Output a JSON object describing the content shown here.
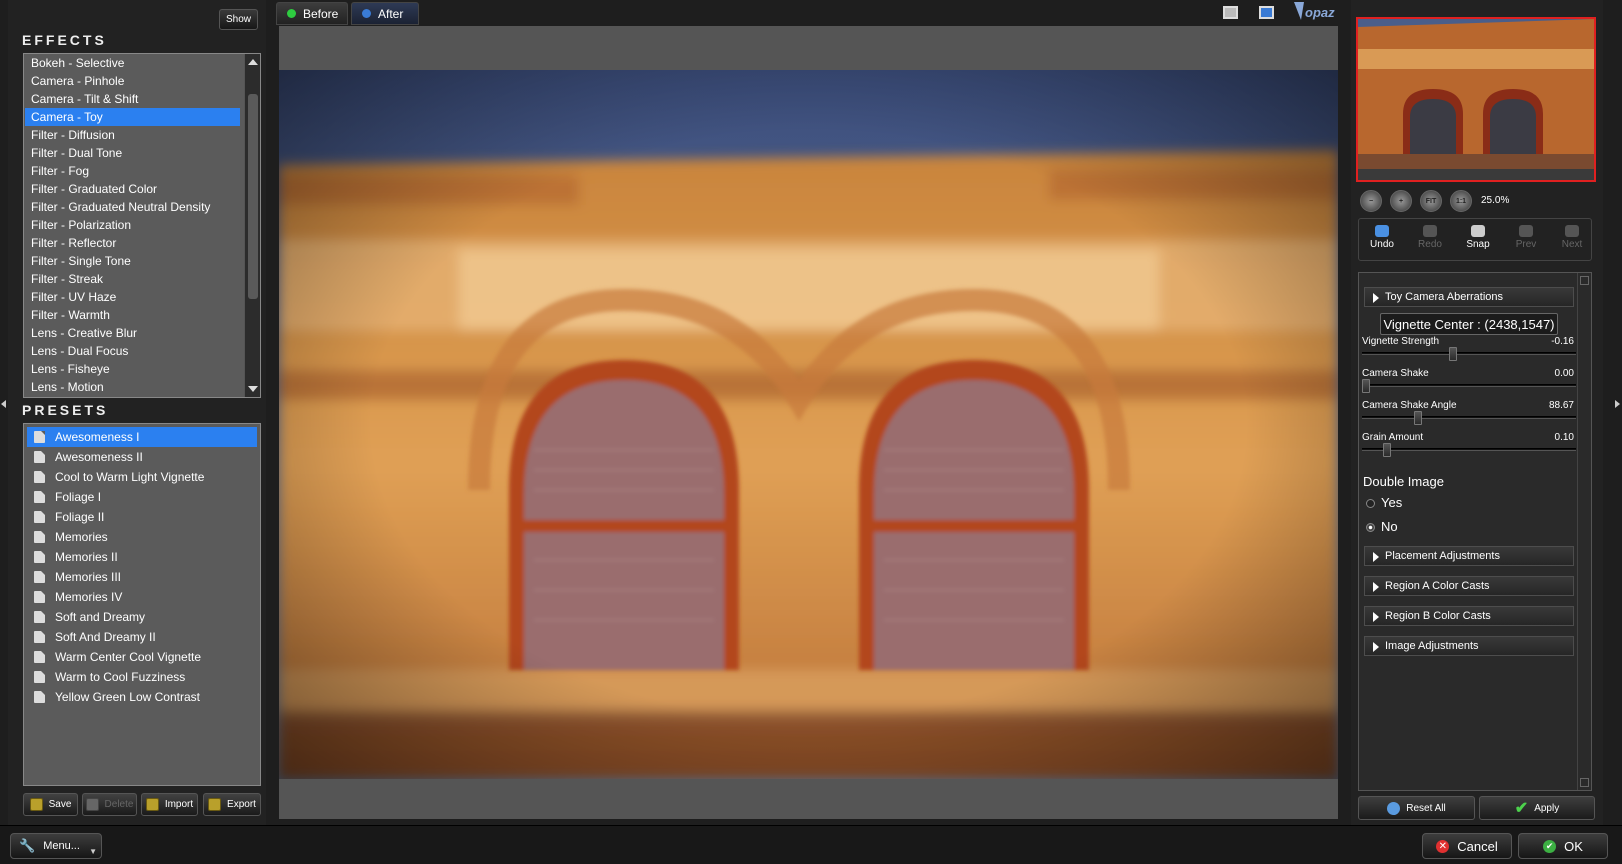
{
  "left_panel": {
    "show_label": "Show",
    "effects_title": "EFFECTS",
    "effects": [
      "Bokeh - Selective",
      "Camera - Pinhole",
      "Camera - Tilt & Shift",
      "Camera - Toy",
      "Filter - Diffusion",
      "Filter - Dual Tone",
      "Filter - Fog",
      "Filter - Graduated Color",
      "Filter - Graduated Neutral Density",
      "Filter - Polarization",
      "Filter - Reflector",
      "Filter - Single Tone",
      "Filter - Streak",
      "Filter - UV Haze",
      "Filter - Warmth",
      "Lens - Creative Blur",
      "Lens - Dual Focus",
      "Lens - Fisheye",
      "Lens - Motion"
    ],
    "selected_effect": "Camera - Toy",
    "presets_title": "PRESETS",
    "presets": [
      "Awesomeness I",
      "Awesomeness II",
      "Cool to Warm Light Vignette",
      "Foliage I",
      "Foliage II",
      "Memories",
      "Memories II",
      "Memories III",
      "Memories IV",
      "Soft and Dreamy",
      "Soft And Dreamy II",
      "Warm Center Cool Vignette",
      "Warm to Cool Fuzziness",
      "Yellow Green Low Contrast"
    ],
    "selected_preset": "Awesomeness I",
    "buttons": {
      "save": "Save",
      "delete": "Delete",
      "import": "Import",
      "export": "Export"
    }
  },
  "view": {
    "before_label": "Before",
    "after_label": "After",
    "active": "After",
    "before_dot_color": "#2ecc40",
    "after_dot_color": "#3a7bd5"
  },
  "navigator": {
    "zoom": "25.0%",
    "fit_label": "FIT",
    "one_to_one_label": "1:1"
  },
  "history": {
    "undo": "Undo",
    "redo": "Redo",
    "snap": "Snap",
    "prev": "Prev",
    "next": "Next"
  },
  "settings": {
    "toy_section": "Toy Camera Aberrations",
    "vignette_center": "Vignette Center : (2438,1547)",
    "sliders": [
      {
        "label": "Vignette Strength",
        "value": "-0.16",
        "pos": 0.42
      },
      {
        "label": "Camera Shake",
        "value": "0.00",
        "pos": 0.0
      },
      {
        "label": "Camera Shake Angle",
        "value": "88.67",
        "pos": 0.25
      },
      {
        "label": "Grain Amount",
        "value": "0.10",
        "pos": 0.1
      }
    ],
    "double_image_label": "Double Image",
    "options": [
      "Yes",
      "No"
    ],
    "selected_option": "No",
    "sections": [
      "Placement Adjustments",
      "Region A Color Casts",
      "Region B Color Casts",
      "Image Adjustments"
    ],
    "reset_all": "Reset All",
    "apply": "Apply"
  },
  "bottom": {
    "menu": "Menu...",
    "cancel": "Cancel",
    "ok": "OK"
  },
  "colors": {
    "selection": "#2b80f0",
    "thumb_border": "#e02020",
    "list_bg": "#5b5b5b"
  }
}
